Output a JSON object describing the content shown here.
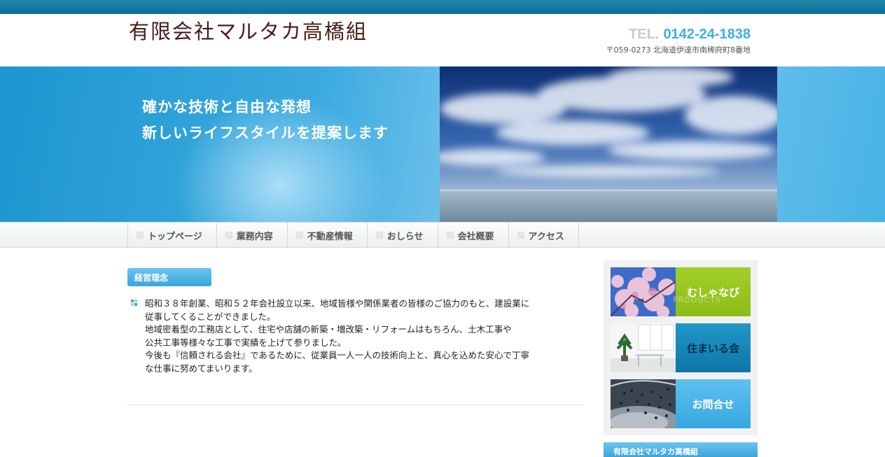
{
  "header": {
    "logo": "有限会社マルタカ高橋組",
    "tel_prefix": "TEL.",
    "tel_number": "0142-24-1838",
    "address": "〒059-0273 北海道伊達市南稀府町8番地"
  },
  "hero": {
    "line1": "確かな技術と自由な発想",
    "line2": "新しいライフスタイルを提案します"
  },
  "nav": {
    "items": [
      {
        "label": "トップページ"
      },
      {
        "label": "業務内容"
      },
      {
        "label": "不動産情報"
      },
      {
        "label": "おしらせ"
      },
      {
        "label": "会社概要"
      },
      {
        "label": "アクセス"
      }
    ]
  },
  "main": {
    "section_title": "経営理念",
    "lines": [
      "昭和３８年創業、昭和５２年会社設立以来、地域皆様や関係業者の皆様のご協力のもと、建設業に",
      "従事してくることができました。",
      "地域密着型の工務店として、住宅や店舗の新築・増改築・リフォームはもちろん、土木工事や",
      "公共工事等様々な工事で実績を上げて参りました。",
      "今後も『信頼される会社』であるために、従業員一人一人の技術向上と、真心を込めた安心で丁寧",
      "な仕事に努めてまいります。"
    ]
  },
  "sidebar": {
    "banners": [
      {
        "label": "むしゃなび",
        "ghost": "PRODUCTS"
      },
      {
        "label": "住まいる会"
      },
      {
        "label": "お問合せ"
      }
    ],
    "footer_title": "有限会社マルタカ高橋組"
  },
  "colors": {
    "accent": "#3aa6dd",
    "topbar": "#0f6f95",
    "green": "#8cbd15"
  }
}
